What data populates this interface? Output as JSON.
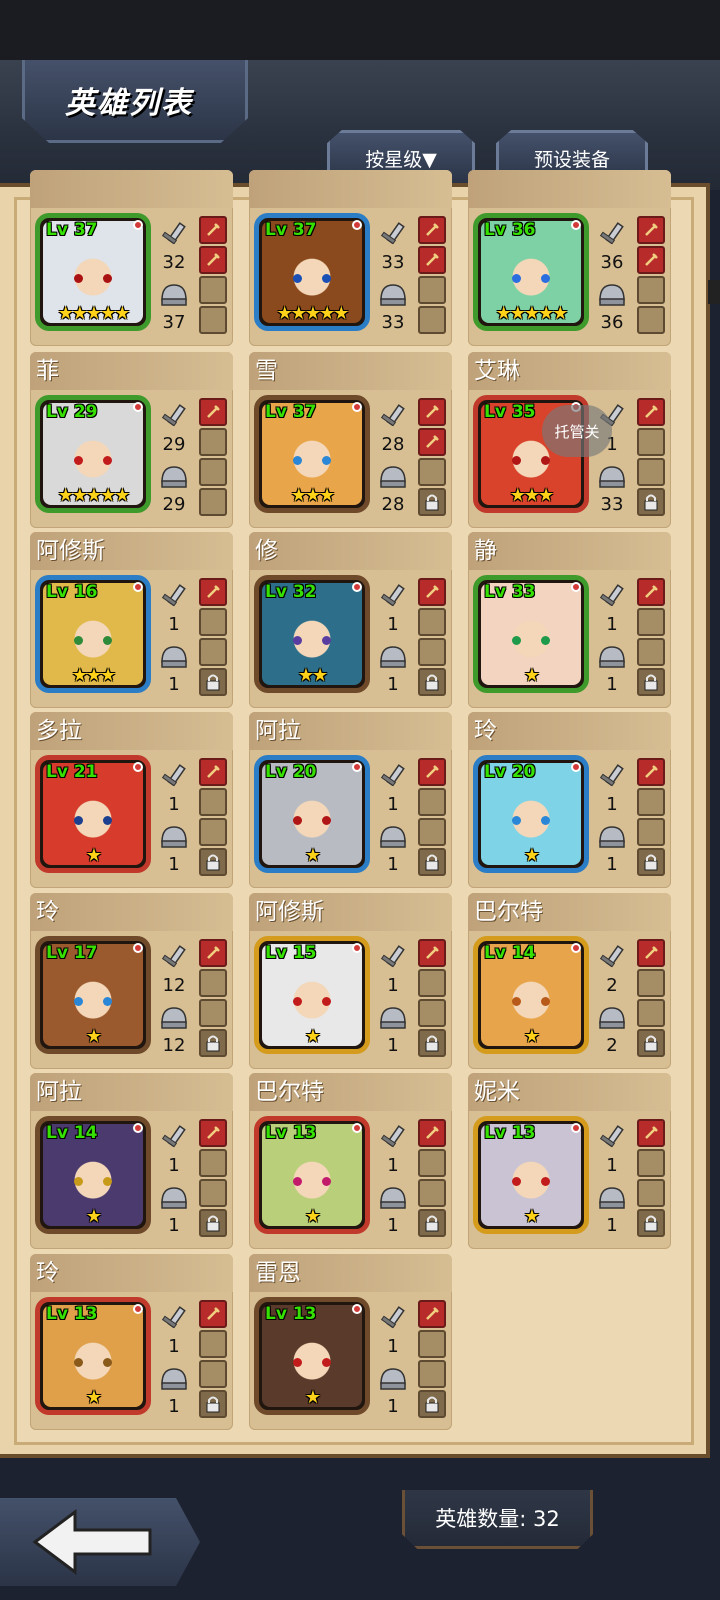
{
  "header": {
    "title": "英雄列表",
    "sort_button": "按星级▼",
    "preset_button": "预设装备"
  },
  "hosting_button": "托管关",
  "footer": {
    "count_label": "英雄数量: 32"
  },
  "heroes": [
    {
      "name": "",
      "level": "Lv 37",
      "attack": "32",
      "defense": "37",
      "stars": 5,
      "frame": "#3f9a2c",
      "hair": "#dfe3ea",
      "eye": "#a11",
      "slots": [
        "eq",
        "eq",
        "empty",
        "empty"
      ]
    },
    {
      "name": "",
      "level": "Lv 37",
      "attack": "33",
      "defense": "33",
      "stars": 5,
      "frame": "#2b7dc6",
      "hair": "#8a4a1e",
      "eye": "#1a4fb5",
      "slots": [
        "eq",
        "eq",
        "empty",
        "empty"
      ]
    },
    {
      "name": "",
      "level": "Lv 36",
      "attack": "36",
      "defense": "36",
      "stars": 5,
      "frame": "#3f9a2c",
      "hair": "#7ed1a4",
      "eye": "#2a6ee0",
      "slots": [
        "eq",
        "eq",
        "empty",
        "empty"
      ]
    },
    {
      "name": "菲",
      "level": "Lv 29",
      "attack": "29",
      "defense": "29",
      "stars": 5,
      "frame": "#3f9a2c",
      "hair": "#d9d9d9",
      "eye": "#c21b1b",
      "slots": [
        "eq",
        "empty",
        "empty",
        "empty"
      ]
    },
    {
      "name": "雪",
      "level": "Lv 37",
      "attack": "28",
      "defense": "28",
      "stars": 3,
      "frame": "#6e4a2a",
      "hair": "#e9a54a",
      "eye": "#2a86d6",
      "slots": [
        "eq",
        "eq",
        "empty",
        "lock"
      ]
    },
    {
      "name": "艾琳",
      "level": "Lv 35",
      "attack": "1",
      "defense": "33",
      "stars": 3,
      "frame": "#c0392b",
      "hair": "#d9432b",
      "eye": "#b01616",
      "slots": [
        "eq",
        "empty",
        "empty",
        "lock"
      ]
    },
    {
      "name": "阿修斯",
      "level": "Lv 16",
      "attack": "1",
      "defense": "1",
      "stars": 3,
      "frame": "#2b7dc6",
      "hair": "#e0b94a",
      "eye": "#2f8a3a",
      "slots": [
        "eq",
        "empty",
        "empty",
        "lock"
      ]
    },
    {
      "name": "修",
      "level": "Lv 32",
      "attack": "1",
      "defense": "1",
      "stars": 2,
      "frame": "#6e4a2a",
      "hair": "#2d6f8a",
      "eye": "#5a3da0",
      "slots": [
        "eq",
        "empty",
        "empty",
        "lock"
      ]
    },
    {
      "name": "静",
      "level": "Lv 33",
      "attack": "1",
      "defense": "1",
      "stars": 1,
      "frame": "#3f9a2c",
      "hair": "#f2d4c0",
      "eye": "#1e9a4a",
      "slots": [
        "eq",
        "empty",
        "empty",
        "lock"
      ]
    },
    {
      "name": "多拉",
      "level": "Lv 21",
      "attack": "1",
      "defense": "1",
      "stars": 1,
      "frame": "#c0392b",
      "hair": "#d63b2b",
      "eye": "#1c3f8f",
      "slots": [
        "eq",
        "empty",
        "empty",
        "lock"
      ]
    },
    {
      "name": "阿拉",
      "level": "Lv 20",
      "attack": "1",
      "defense": "1",
      "stars": 1,
      "frame": "#2b7dc6",
      "hair": "#b8bcc2",
      "eye": "#b01616",
      "slots": [
        "eq",
        "empty",
        "empty",
        "lock"
      ]
    },
    {
      "name": "玲",
      "level": "Lv 20",
      "attack": "1",
      "defense": "1",
      "stars": 1,
      "frame": "#2b7dc6",
      "hair": "#7fd3e6",
      "eye": "#2a86d6",
      "slots": [
        "eq",
        "empty",
        "empty",
        "lock"
      ]
    },
    {
      "name": "玲",
      "level": "Lv 17",
      "attack": "12",
      "defense": "12",
      "stars": 1,
      "frame": "#6e4a2a",
      "hair": "#9a5a2e",
      "eye": "#2a86d6",
      "slots": [
        "eq",
        "empty",
        "empty",
        "lock"
      ]
    },
    {
      "name": "阿修斯",
      "level": "Lv 15",
      "attack": "1",
      "defense": "1",
      "stars": 1,
      "frame": "#d49b1c",
      "hair": "#e8e8e8",
      "eye": "#c21b1b",
      "slots": [
        "eq",
        "empty",
        "empty",
        "lock"
      ]
    },
    {
      "name": "巴尔特",
      "level": "Lv 14",
      "attack": "2",
      "defense": "2",
      "stars": 1,
      "frame": "#d49b1c",
      "hair": "#e8a44a",
      "eye": "#b85a1a",
      "slots": [
        "eq",
        "empty",
        "empty",
        "lock"
      ]
    },
    {
      "name": "阿拉",
      "level": "Lv 14",
      "attack": "1",
      "defense": "1",
      "stars": 1,
      "frame": "#6e4a2a",
      "hair": "#4b3a6e",
      "eye": "#c79a1a",
      "slots": [
        "eq",
        "empty",
        "empty",
        "lock"
      ]
    },
    {
      "name": "巴尔特",
      "level": "Lv 13",
      "attack": "1",
      "defense": "1",
      "stars": 1,
      "frame": "#c0392b",
      "hair": "#b9cf7a",
      "eye": "#c21b6b",
      "slots": [
        "eq",
        "empty",
        "empty",
        "lock"
      ]
    },
    {
      "name": "妮米",
      "level": "Lv 13",
      "attack": "1",
      "defense": "1",
      "stars": 1,
      "frame": "#d49b1c",
      "hair": "#c9c3d3",
      "eye": "#c21b1b",
      "slots": [
        "eq",
        "empty",
        "empty",
        "lock"
      ]
    },
    {
      "name": "玲",
      "level": "Lv 13",
      "attack": "1",
      "defense": "1",
      "stars": 1,
      "frame": "#c0392b",
      "hair": "#e0a04a",
      "eye": "#8a5a1a",
      "slots": [
        "eq",
        "empty",
        "empty",
        "lock"
      ]
    },
    {
      "name": "雷恩",
      "level": "Lv 13",
      "attack": "1",
      "defense": "1",
      "stars": 1,
      "frame": "#6e4a2a",
      "hair": "#5a3a2a",
      "eye": "#c21b1b",
      "slots": [
        "eq",
        "empty",
        "empty",
        "lock"
      ]
    }
  ],
  "icons": {
    "sword": "sword-icon",
    "helmet": "helmet-icon",
    "lock": "lock-icon",
    "back": "back-arrow-icon"
  }
}
